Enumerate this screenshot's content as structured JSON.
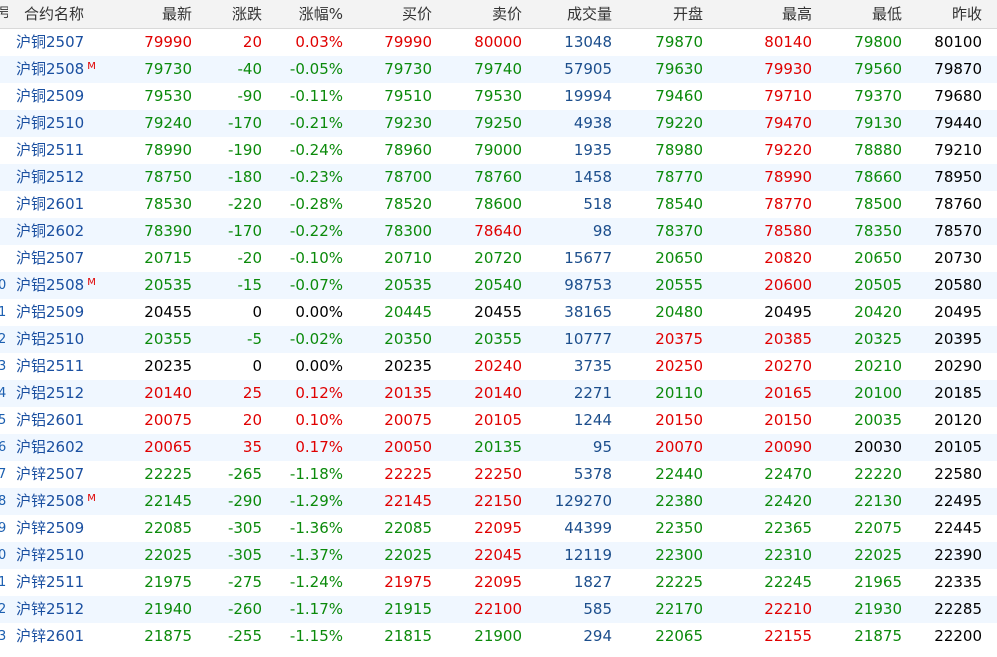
{
  "headers": {
    "idx": "号",
    "name": "合约名称",
    "last": "最新",
    "chg": "涨跌",
    "pct": "涨幅%",
    "bid": "买价",
    "ask": "卖价",
    "vol": "成交量",
    "open": "开盘",
    "high": "最高",
    "low": "最低",
    "pre": "昨收"
  },
  "colors": {
    "up": "#e00000",
    "down": "#0b8a0b",
    "flat": "#000000",
    "name": "#1a4fa0",
    "volume": "#1c4e8c",
    "row_alt": "#f0f7ff",
    "header_bg": "#f3f3f3"
  },
  "main_badge": "M",
  "rows": [
    {
      "idx": "",
      "name": "沪铜2507",
      "main": false,
      "last": "79990",
      "chg": "20",
      "pct": "0.03%",
      "bid": "79990",
      "ask": "80000",
      "vol": "13048",
      "open": "79870",
      "high": "80140",
      "low": "79800",
      "pre": "80100",
      "dir": {
        "last": "up",
        "chg": "up",
        "pct": "up",
        "bid": "up",
        "ask": "up",
        "open": "down",
        "high": "up",
        "low": "down"
      }
    },
    {
      "idx": "",
      "name": "沪铜2508",
      "main": true,
      "last": "79730",
      "chg": "-40",
      "pct": "-0.05%",
      "bid": "79730",
      "ask": "79740",
      "vol": "57905",
      "open": "79630",
      "high": "79930",
      "low": "79560",
      "pre": "79870",
      "dir": {
        "last": "down",
        "chg": "down",
        "pct": "down",
        "bid": "down",
        "ask": "down",
        "open": "down",
        "high": "up",
        "low": "down"
      }
    },
    {
      "idx": "",
      "name": "沪铜2509",
      "main": false,
      "last": "79530",
      "chg": "-90",
      "pct": "-0.11%",
      "bid": "79510",
      "ask": "79530",
      "vol": "19994",
      "open": "79460",
      "high": "79710",
      "low": "79370",
      "pre": "79680",
      "dir": {
        "last": "down",
        "chg": "down",
        "pct": "down",
        "bid": "down",
        "ask": "down",
        "open": "down",
        "high": "up",
        "low": "down"
      }
    },
    {
      "idx": "",
      "name": "沪铜2510",
      "main": false,
      "last": "79240",
      "chg": "-170",
      "pct": "-0.21%",
      "bid": "79230",
      "ask": "79250",
      "vol": "4938",
      "open": "79220",
      "high": "79470",
      "low": "79130",
      "pre": "79440",
      "dir": {
        "last": "down",
        "chg": "down",
        "pct": "down",
        "bid": "down",
        "ask": "down",
        "open": "down",
        "high": "up",
        "low": "down"
      }
    },
    {
      "idx": "",
      "name": "沪铜2511",
      "main": false,
      "last": "78990",
      "chg": "-190",
      "pct": "-0.24%",
      "bid": "78960",
      "ask": "79000",
      "vol": "1935",
      "open": "78980",
      "high": "79220",
      "low": "78880",
      "pre": "79210",
      "dir": {
        "last": "down",
        "chg": "down",
        "pct": "down",
        "bid": "down",
        "ask": "down",
        "open": "down",
        "high": "up",
        "low": "down"
      }
    },
    {
      "idx": "",
      "name": "沪铜2512",
      "main": false,
      "last": "78750",
      "chg": "-180",
      "pct": "-0.23%",
      "bid": "78700",
      "ask": "78760",
      "vol": "1458",
      "open": "78770",
      "high": "78990",
      "low": "78660",
      "pre": "78950",
      "dir": {
        "last": "down",
        "chg": "down",
        "pct": "down",
        "bid": "down",
        "ask": "down",
        "open": "down",
        "high": "up",
        "low": "down"
      }
    },
    {
      "idx": "",
      "name": "沪铜2601",
      "main": false,
      "last": "78530",
      "chg": "-220",
      "pct": "-0.28%",
      "bid": "78520",
      "ask": "78600",
      "vol": "518",
      "open": "78540",
      "high": "78770",
      "low": "78500",
      "pre": "78760",
      "dir": {
        "last": "down",
        "chg": "down",
        "pct": "down",
        "bid": "down",
        "ask": "down",
        "open": "down",
        "high": "up",
        "low": "down"
      }
    },
    {
      "idx": "",
      "name": "沪铜2602",
      "main": false,
      "last": "78390",
      "chg": "-170",
      "pct": "-0.22%",
      "bid": "78300",
      "ask": "78640",
      "vol": "98",
      "open": "78370",
      "high": "78580",
      "low": "78350",
      "pre": "78570",
      "dir": {
        "last": "down",
        "chg": "down",
        "pct": "down",
        "bid": "down",
        "ask": "up",
        "open": "down",
        "high": "up",
        "low": "down"
      }
    },
    {
      "idx": "",
      "name": "沪铝2507",
      "main": false,
      "last": "20715",
      "chg": "-20",
      "pct": "-0.10%",
      "bid": "20710",
      "ask": "20720",
      "vol": "15677",
      "open": "20650",
      "high": "20820",
      "low": "20650",
      "pre": "20730",
      "dir": {
        "last": "down",
        "chg": "down",
        "pct": "down",
        "bid": "down",
        "ask": "down",
        "open": "down",
        "high": "up",
        "low": "down"
      }
    },
    {
      "idx": "0",
      "name": "沪铝2508",
      "main": true,
      "last": "20535",
      "chg": "-15",
      "pct": "-0.07%",
      "bid": "20535",
      "ask": "20540",
      "vol": "98753",
      "open": "20555",
      "high": "20600",
      "low": "20505",
      "pre": "20580",
      "dir": {
        "last": "down",
        "chg": "down",
        "pct": "down",
        "bid": "down",
        "ask": "down",
        "open": "down",
        "high": "up",
        "low": "down"
      }
    },
    {
      "idx": "1",
      "name": "沪铝2509",
      "main": false,
      "last": "20455",
      "chg": "0",
      "pct": "0.00%",
      "bid": "20445",
      "ask": "20455",
      "vol": "38165",
      "open": "20480",
      "high": "20495",
      "low": "20420",
      "pre": "20495",
      "dir": {
        "last": "flat",
        "chg": "flat",
        "pct": "flat",
        "bid": "down",
        "ask": "flat",
        "open": "down",
        "high": "flat",
        "low": "down"
      }
    },
    {
      "idx": "2",
      "name": "沪铝2510",
      "main": false,
      "last": "20355",
      "chg": "-5",
      "pct": "-0.02%",
      "bid": "20350",
      "ask": "20355",
      "vol": "10777",
      "open": "20375",
      "high": "20385",
      "low": "20325",
      "pre": "20395",
      "dir": {
        "last": "down",
        "chg": "down",
        "pct": "down",
        "bid": "down",
        "ask": "down",
        "open": "up",
        "high": "up",
        "low": "down"
      }
    },
    {
      "idx": "3",
      "name": "沪铝2511",
      "main": false,
      "last": "20235",
      "chg": "0",
      "pct": "0.00%",
      "bid": "20235",
      "ask": "20240",
      "vol": "3735",
      "open": "20250",
      "high": "20270",
      "low": "20210",
      "pre": "20290",
      "dir": {
        "last": "flat",
        "chg": "flat",
        "pct": "flat",
        "bid": "flat",
        "ask": "up",
        "open": "up",
        "high": "up",
        "low": "down"
      }
    },
    {
      "idx": "4",
      "name": "沪铝2512",
      "main": false,
      "last": "20140",
      "chg": "25",
      "pct": "0.12%",
      "bid": "20135",
      "ask": "20140",
      "vol": "2271",
      "open": "20110",
      "high": "20165",
      "low": "20100",
      "pre": "20185",
      "dir": {
        "last": "up",
        "chg": "up",
        "pct": "up",
        "bid": "up",
        "ask": "up",
        "open": "down",
        "high": "up",
        "low": "down"
      }
    },
    {
      "idx": "5",
      "name": "沪铝2601",
      "main": false,
      "last": "20075",
      "chg": "20",
      "pct": "0.10%",
      "bid": "20075",
      "ask": "20105",
      "vol": "1244",
      "open": "20150",
      "high": "20150",
      "low": "20035",
      "pre": "20120",
      "dir": {
        "last": "up",
        "chg": "up",
        "pct": "up",
        "bid": "up",
        "ask": "up",
        "open": "up",
        "high": "up",
        "low": "down"
      }
    },
    {
      "idx": "6",
      "name": "沪铝2602",
      "main": false,
      "last": "20065",
      "chg": "35",
      "pct": "0.17%",
      "bid": "20050",
      "ask": "20135",
      "vol": "95",
      "open": "20070",
      "high": "20090",
      "low": "20030",
      "pre": "20105",
      "dir": {
        "last": "up",
        "chg": "up",
        "pct": "up",
        "bid": "up",
        "ask": "down",
        "open": "up",
        "high": "up",
        "low": "flat"
      }
    },
    {
      "idx": "7",
      "name": "沪锌2507",
      "main": false,
      "last": "22225",
      "chg": "-265",
      "pct": "-1.18%",
      "bid": "22225",
      "ask": "22250",
      "vol": "5378",
      "open": "22440",
      "high": "22470",
      "low": "22220",
      "pre": "22580",
      "dir": {
        "last": "down",
        "chg": "down",
        "pct": "down",
        "bid": "up",
        "ask": "up",
        "open": "down",
        "high": "down",
        "low": "down"
      }
    },
    {
      "idx": "8",
      "name": "沪锌2508",
      "main": true,
      "last": "22145",
      "chg": "-290",
      "pct": "-1.29%",
      "bid": "22145",
      "ask": "22150",
      "vol": "129270",
      "open": "22380",
      "high": "22420",
      "low": "22130",
      "pre": "22495",
      "dir": {
        "last": "down",
        "chg": "down",
        "pct": "down",
        "bid": "up",
        "ask": "up",
        "open": "down",
        "high": "down",
        "low": "down"
      }
    },
    {
      "idx": "9",
      "name": "沪锌2509",
      "main": false,
      "last": "22085",
      "chg": "-305",
      "pct": "-1.36%",
      "bid": "22085",
      "ask": "22095",
      "vol": "44399",
      "open": "22350",
      "high": "22365",
      "low": "22075",
      "pre": "22445",
      "dir": {
        "last": "down",
        "chg": "down",
        "pct": "down",
        "bid": "down",
        "ask": "up",
        "open": "down",
        "high": "down",
        "low": "down"
      }
    },
    {
      "idx": "0",
      "name": "沪锌2510",
      "main": false,
      "last": "22025",
      "chg": "-305",
      "pct": "-1.37%",
      "bid": "22025",
      "ask": "22045",
      "vol": "12119",
      "open": "22300",
      "high": "22310",
      "low": "22025",
      "pre": "22390",
      "dir": {
        "last": "down",
        "chg": "down",
        "pct": "down",
        "bid": "down",
        "ask": "up",
        "open": "down",
        "high": "down",
        "low": "down"
      }
    },
    {
      "idx": "1",
      "name": "沪锌2511",
      "main": false,
      "last": "21975",
      "chg": "-275",
      "pct": "-1.24%",
      "bid": "21975",
      "ask": "22095",
      "vol": "1827",
      "open": "22225",
      "high": "22245",
      "low": "21965",
      "pre": "22335",
      "dir": {
        "last": "down",
        "chg": "down",
        "pct": "down",
        "bid": "up",
        "ask": "up",
        "open": "down",
        "high": "down",
        "low": "down"
      }
    },
    {
      "idx": "2",
      "name": "沪锌2512",
      "main": false,
      "last": "21940",
      "chg": "-260",
      "pct": "-1.17%",
      "bid": "21915",
      "ask": "22100",
      "vol": "585",
      "open": "22170",
      "high": "22210",
      "low": "21930",
      "pre": "22285",
      "dir": {
        "last": "down",
        "chg": "down",
        "pct": "down",
        "bid": "down",
        "ask": "up",
        "open": "down",
        "high": "up",
        "low": "down"
      }
    },
    {
      "idx": "3",
      "name": "沪锌2601",
      "main": false,
      "last": "21875",
      "chg": "-255",
      "pct": "-1.15%",
      "bid": "21815",
      "ask": "21900",
      "vol": "294",
      "open": "22065",
      "high": "22155",
      "low": "21875",
      "pre": "22200",
      "dir": {
        "last": "down",
        "chg": "down",
        "pct": "down",
        "bid": "down",
        "ask": "down",
        "open": "down",
        "high": "up",
        "low": "down"
      }
    }
  ]
}
